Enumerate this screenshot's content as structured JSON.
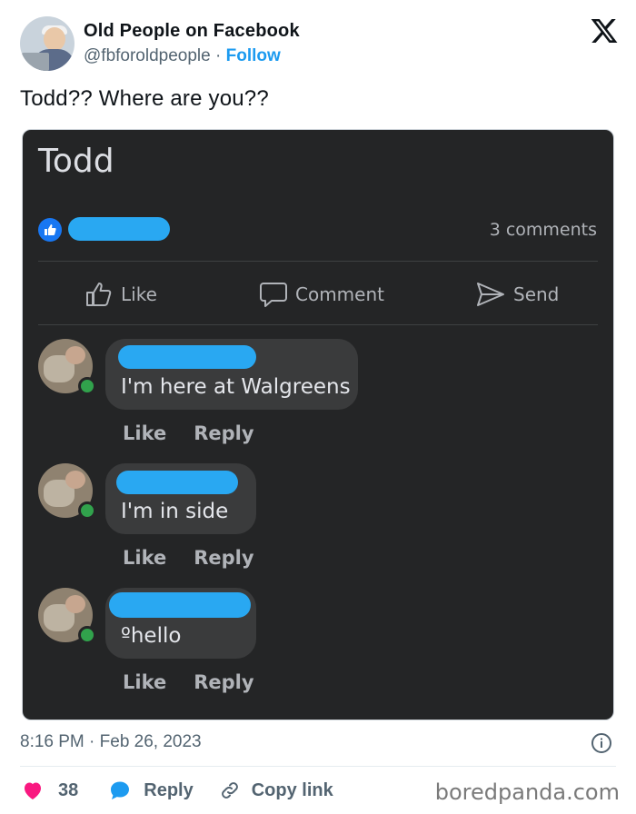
{
  "account": {
    "name": "Old People on Facebook",
    "handle": "@fbforoldpeople",
    "separator": "·",
    "follow_label": "Follow"
  },
  "tweet": {
    "text": "Todd?? Where are you??",
    "timestamp": "8:16 PM · Feb 26, 2023"
  },
  "screenshot": {
    "post_title": "Todd",
    "comment_count": "3 comments",
    "actions": {
      "like": "Like",
      "comment": "Comment",
      "send": "Send"
    },
    "comments": [
      {
        "text": "I'm here at Walgreens",
        "like": "Like",
        "reply": "Reply"
      },
      {
        "text": "I'm in side",
        "like": "Like",
        "reply": "Reply"
      },
      {
        "text": "ºhello",
        "like": "Like",
        "reply": "Reply"
      }
    ]
  },
  "footer": {
    "like_count": "38",
    "reply_label": "Reply",
    "copy_link_label": "Copy link",
    "watermark": "boredpanda.com"
  },
  "colors": {
    "follow_blue": "#1d9bf0",
    "heart_red": "#f91880",
    "fb_dark_bg": "#242526",
    "bubble_bg": "#3a3b3c",
    "redaction_blue": "#29a8f2",
    "online_green": "#31a24c"
  },
  "icons": [
    "x-logo-icon",
    "thumbs-up-icon",
    "comment-icon",
    "send-icon",
    "info-icon",
    "heart-icon",
    "speech-bubble-icon",
    "link-icon"
  ]
}
